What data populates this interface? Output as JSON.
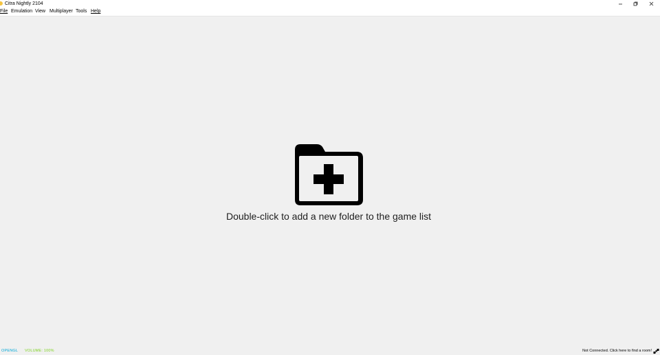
{
  "window": {
    "title": "Citra Nightly 2104",
    "controls": {
      "minimize_icon": "minimize-icon",
      "restore_icon": "restore-icon",
      "close_icon": "close-icon"
    }
  },
  "menubar": {
    "items": [
      {
        "label": "File",
        "mnemonic": "F"
      },
      {
        "label": "Emulation"
      },
      {
        "label": "View"
      },
      {
        "label": "Multiplayer"
      },
      {
        "label": "Tools"
      },
      {
        "label": "Help",
        "mnemonic": "H"
      }
    ]
  },
  "game_list": {
    "icon": "folder-add-icon",
    "placeholder": "Double-click to add a new folder to the game list"
  },
  "statusbar": {
    "graphics_api": "OPENGL",
    "volume": "VOLUME: 100%",
    "network_status": "Not Connected. Click here to find a room!",
    "network_icon": "network-disconnected-icon"
  },
  "colors": {
    "background": "#f0f0f0",
    "api_label": "#00a8d8",
    "volume_label": "#7ed321",
    "app_icon": "#f5c542"
  }
}
